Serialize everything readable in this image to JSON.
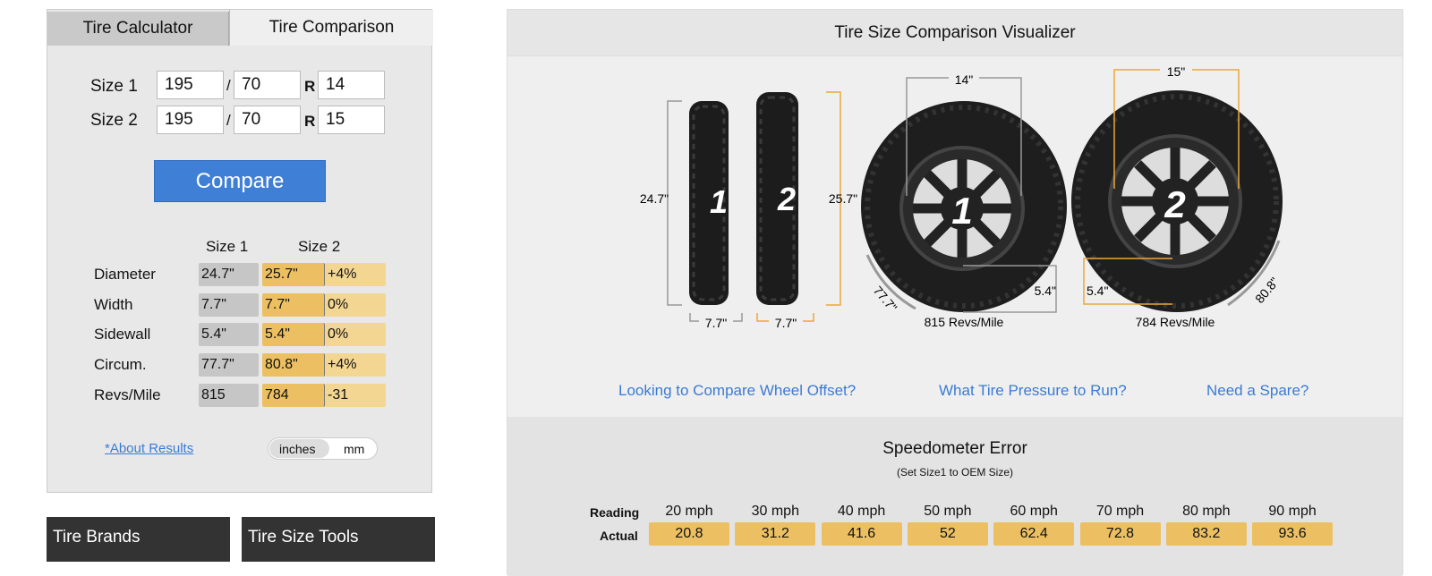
{
  "tabs": {
    "calculator": "Tire Calculator",
    "comparison": "Tire Comparison"
  },
  "form": {
    "size1_label": "Size 1",
    "size2_label": "Size 2",
    "slash": "/",
    "r": "R",
    "size1": {
      "width": "195",
      "aspect": "70",
      "rim": "14"
    },
    "size2": {
      "width": "195",
      "aspect": "70",
      "rim": "15"
    },
    "compare_label": "Compare"
  },
  "results": {
    "col1": "Size 1",
    "col2": "Size 2",
    "rows": [
      {
        "label": "Diameter",
        "s1": "24.7\"",
        "s2": "25.7\"",
        "diff": "+4%"
      },
      {
        "label": "Width",
        "s1": "7.7\"",
        "s2": "7.7\"",
        "diff": "0%"
      },
      {
        "label": "Sidewall",
        "s1": "5.4\"",
        "s2": "5.4\"",
        "diff": "0%"
      },
      {
        "label": "Circum.",
        "s1": "77.7\"",
        "s2": "80.8\"",
        "diff": "+4%"
      },
      {
        "label": "Revs/Mile",
        "s1": "815",
        "s2": "784",
        "diff": "-31"
      }
    ]
  },
  "about_link": "*About Results",
  "units": {
    "inches": "inches",
    "mm": "mm",
    "selected": "inches"
  },
  "bottom": {
    "brands": "Tire Brands",
    "tools": "Tire Size Tools"
  },
  "visualizer": {
    "title": "Tire Size Comparison Visualizer",
    "tire1": {
      "num": "1",
      "diameter": "24.7\"",
      "width": "7.7\"",
      "rim": "14\"",
      "sidewall": "5.4\"",
      "circ": "77.7\"",
      "revs": "815 Revs/Mile"
    },
    "tire2": {
      "num": "2",
      "diameter": "25.7\"",
      "width": "7.7\"",
      "rim": "15\"",
      "sidewall": "5.4\"",
      "circ": "80.8\"",
      "revs": "784 Revs/Mile"
    },
    "links": [
      "Looking to Compare Wheel Offset?",
      "What Tire Pressure to Run?",
      "Need a Spare?"
    ],
    "colors": {
      "size1": "#999999",
      "size2": "#e8a83a"
    }
  },
  "speedometer": {
    "title": "Speedometer Error",
    "subtitle": "(Set Size1 to OEM Size)",
    "reading_label": "Reading",
    "actual_label": "Actual",
    "readings": [
      "20 mph",
      "30 mph",
      "40 mph",
      "50 mph",
      "60 mph",
      "70 mph",
      "80 mph",
      "90 mph"
    ],
    "actual": [
      "20.8",
      "31.2",
      "41.6",
      "52",
      "62.4",
      "72.8",
      "83.2",
      "93.6"
    ]
  }
}
